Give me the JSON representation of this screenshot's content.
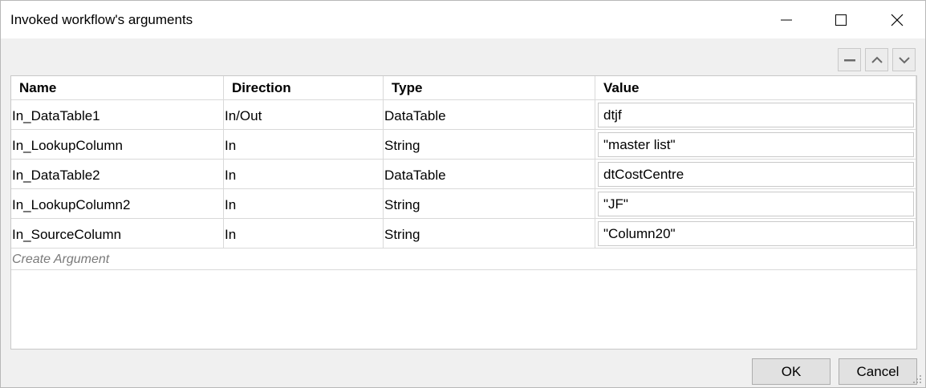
{
  "window": {
    "title": "Invoked workflow's arguments"
  },
  "controls": {
    "minimize_icon": "minimize-icon",
    "maximize_icon": "maximize-icon",
    "close_icon": "close-icon"
  },
  "toolbar": {
    "remove_icon": "minus-icon",
    "up_icon": "chevron-up-icon",
    "down_icon": "chevron-down-icon"
  },
  "grid": {
    "columns": [
      "Name",
      "Direction",
      "Type",
      "Value"
    ],
    "rows": [
      {
        "name": "In_DataTable1",
        "direction": "In/Out",
        "type": "DataTable",
        "value": "dtjf"
      },
      {
        "name": "In_LookupColumn",
        "direction": "In",
        "type": "String",
        "value": "\"master list\""
      },
      {
        "name": "In_DataTable2",
        "direction": "In",
        "type": "DataTable",
        "value": "dtCostCentre"
      },
      {
        "name": "In_LookupColumn2",
        "direction": "In",
        "type": "String",
        "value": "\"JF\""
      },
      {
        "name": "In_SourceColumn",
        "direction": "In",
        "type": "String",
        "value": "\"Column20\""
      }
    ],
    "create_label": "Create Argument"
  },
  "footer": {
    "ok_label": "OK",
    "cancel_label": "Cancel"
  }
}
